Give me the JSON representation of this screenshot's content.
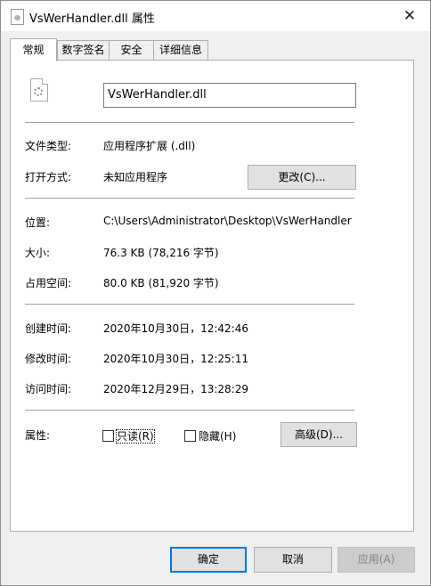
{
  "window": {
    "title": "VsWerHandler.dll 属性",
    "close_glyph": "✕"
  },
  "tabs": [
    {
      "label": "常规",
      "active": true
    },
    {
      "label": "数字签名",
      "active": false
    },
    {
      "label": "安全",
      "active": false
    },
    {
      "label": "详细信息",
      "active": false
    }
  ],
  "general": {
    "file_name": "VsWerHandler.dll",
    "file_type_label": "文件类型:",
    "file_type_value": "应用程序扩展 (.dll)",
    "open_with_label": "打开方式:",
    "open_with_value": "未知应用程序",
    "change_button": "更改(C)...",
    "location_label": "位置:",
    "location_value": "C:\\Users\\Administrator\\Desktop\\VsWerHandler",
    "size_label": "大小:",
    "size_value": "76.3 KB (78,216 字节)",
    "size_on_disk_label": "占用空间:",
    "size_on_disk_value": "80.0 KB (81,920 字节)",
    "created_label": "创建时间:",
    "created_value": "2020年10月30日，12:42:46",
    "modified_label": "修改时间:",
    "modified_value": "2020年10月30日，12:25:11",
    "accessed_label": "访问时间:",
    "accessed_value": "2020年12月29日，13:28:29",
    "attributes_label": "属性:",
    "readonly_label": "只读(R)",
    "readonly_checked": false,
    "hidden_label": "隐藏(H)",
    "hidden_checked": false,
    "advanced_button": "高级(D)..."
  },
  "footer": {
    "ok": "确定",
    "cancel": "取消",
    "apply": "应用(A)"
  },
  "colors": {
    "ok_border": "#0078d7",
    "disabled_text": "#838383"
  }
}
